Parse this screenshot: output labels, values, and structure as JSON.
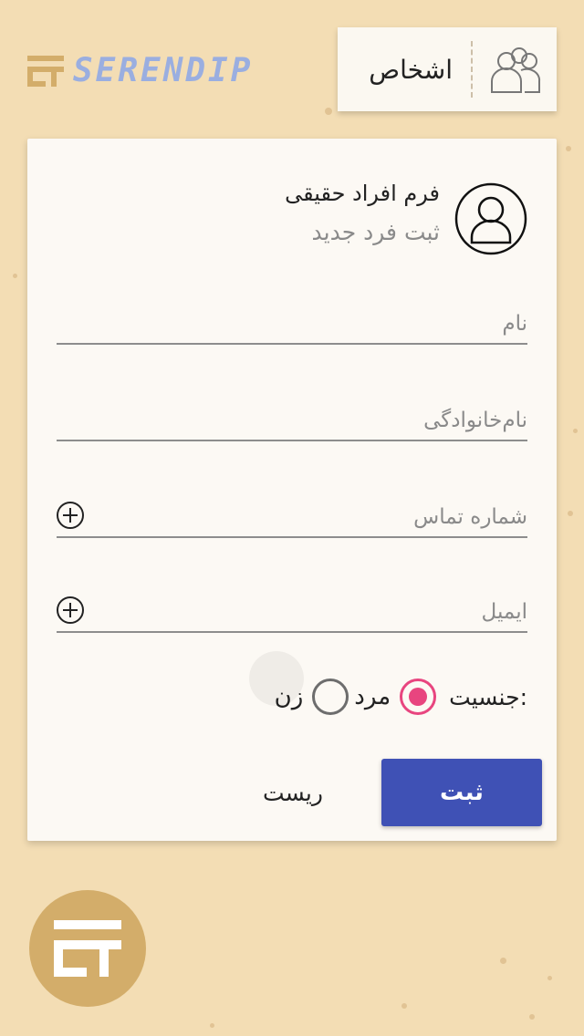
{
  "brand": {
    "name": "SERENDIP",
    "accent": "#9aaee0",
    "mark_color": "#d3ad6a"
  },
  "nav": {
    "people_label": "اشخاص",
    "people_icon": "people-icon"
  },
  "form": {
    "title": "فرم افراد حقیقی",
    "subtitle": "ثبت فرد جدید",
    "avatar_icon": "user-icon",
    "fields": {
      "first_name": "نام",
      "last_name": "نام‌خانوادگی",
      "phone": "شماره تماس",
      "email": "ایمیل"
    },
    "gender": {
      "label": "جنسیت:",
      "options": [
        "مرد",
        "زن"
      ],
      "selected": "مرد",
      "accent": "#e8457f"
    },
    "submit_label": "ثبت",
    "reset_label": "ریست",
    "submit_color": "#3f51b5"
  },
  "background_color": "#f3ddb4"
}
